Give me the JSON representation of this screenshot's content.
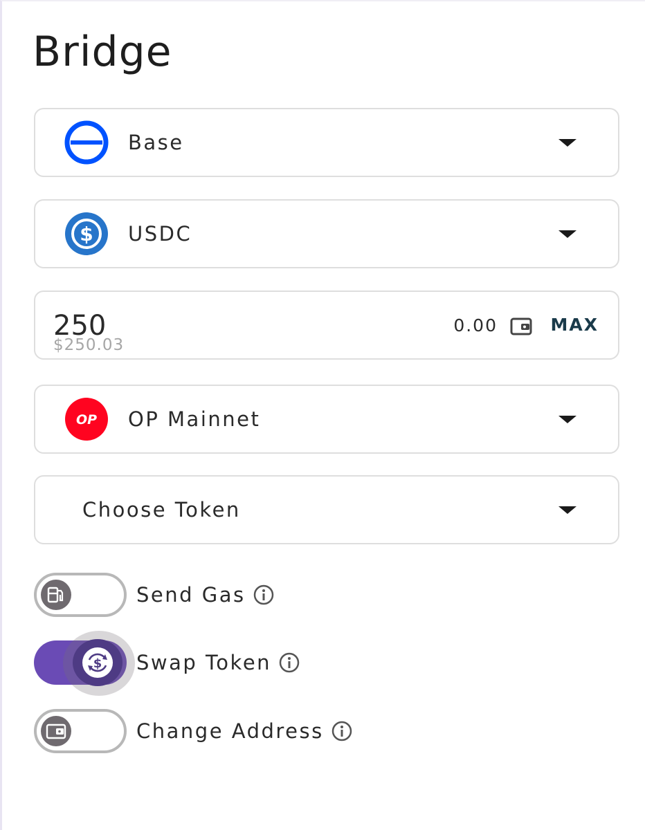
{
  "header": {
    "title": "Bridge"
  },
  "from_chain": {
    "label": "Base",
    "icon": "base-logo-icon",
    "color": "#0052ff"
  },
  "from_token": {
    "label": "USDC",
    "icon": "usdc-logo-icon",
    "color": "#2775ca"
  },
  "amount": {
    "value": "250",
    "usd_value": "$250.03",
    "balance": "0.00",
    "max_label": "MAX"
  },
  "to_chain": {
    "label": "OP Mainnet",
    "icon_text": "OP",
    "icon": "op-logo-icon",
    "color": "#ff0420"
  },
  "to_token": {
    "label": "Choose Token"
  },
  "toggles": [
    {
      "label": "Send Gas",
      "icon": "gas-pump-icon",
      "on": false
    },
    {
      "label": "Swap Token",
      "icon": "swap-currency-icon",
      "on": true
    },
    {
      "label": "Change Address",
      "icon": "wallet-icon",
      "on": false
    }
  ],
  "colors": {
    "toggle_on": "#6a4bb5",
    "toggle_knob_on": "#4e3b84",
    "toggle_knob_off": "#6f6a6f"
  }
}
